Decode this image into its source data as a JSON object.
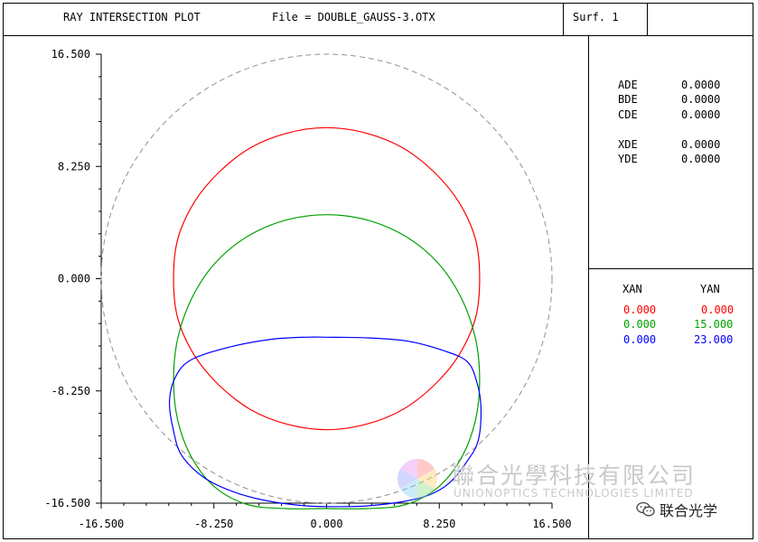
{
  "header": {
    "title": "RAY INTERSECTION PLOT",
    "file_label": "File = DOUBLE_GAUSS-3.OTX",
    "surface_label": "Surf. 1"
  },
  "decenters": [
    {
      "name": "ADE",
      "value": "0.0000"
    },
    {
      "name": "BDE",
      "value": "0.0000"
    },
    {
      "name": "CDE",
      "value": "0.0000"
    },
    {
      "name": "XDE",
      "value": "0.0000"
    },
    {
      "name": "YDE",
      "value": "0.0000"
    }
  ],
  "field_table": {
    "headers": [
      "XAN",
      "YAN"
    ],
    "rows": [
      {
        "xan": "0.000",
        "yan": "0.000",
        "color": "#ff0000"
      },
      {
        "xan": "0.000",
        "yan": "15.000",
        "color": "#00a000"
      },
      {
        "xan": "0.000",
        "yan": "23.000",
        "color": "#0000ff"
      }
    ]
  },
  "watermark": {
    "company_cn": "聯合光學科技有限公司",
    "company_en": "UNIONOPTICS TECHNOLOGIES LIMITED",
    "wechat": "联合光学"
  },
  "chart_data": {
    "type": "line",
    "xlim": [
      -16.5,
      16.5
    ],
    "ylim": [
      -16.5,
      16.5
    ],
    "x_tick_labels": [
      "-16.500",
      "-8.250",
      "0.000",
      "8.250",
      "16.500"
    ],
    "y_tick_labels": [
      "16.500",
      "8.250",
      "0.000",
      "-8.250",
      "-16.500"
    ],
    "x_ticks": [
      -16.5,
      -8.25,
      0,
      8.25,
      16.5
    ],
    "y_ticks": [
      16.5,
      8.25,
      0,
      -8.25,
      -16.5
    ],
    "aperture": {
      "cx": 0,
      "cy": 0,
      "r": 16.5,
      "style": "dashed",
      "color": "#909090"
    },
    "series": [
      {
        "color": "#ff0000",
        "field_yan": 0,
        "points": [
          [
            0.0,
            11.1
          ],
          [
            2.9,
            10.7
          ],
          [
            5.6,
            9.6
          ],
          [
            7.9,
            7.8
          ],
          [
            9.7,
            5.6
          ],
          [
            10.9,
            2.9
          ],
          [
            11.2,
            0.0
          ],
          [
            10.9,
            -2.9
          ],
          [
            9.7,
            -5.6
          ],
          [
            7.9,
            -7.8
          ],
          [
            5.6,
            -9.6
          ],
          [
            2.9,
            -10.7
          ],
          [
            0.0,
            -11.1
          ],
          [
            -2.9,
            -10.7
          ],
          [
            -5.6,
            -9.6
          ],
          [
            -7.9,
            -7.8
          ],
          [
            -9.7,
            -5.6
          ],
          [
            -10.9,
            -2.9
          ],
          [
            -11.2,
            0.0
          ],
          [
            -10.9,
            2.9
          ],
          [
            -9.7,
            5.6
          ],
          [
            -7.9,
            7.8
          ],
          [
            -5.6,
            9.6
          ],
          [
            -2.9,
            10.7
          ],
          [
            0.0,
            11.1
          ]
        ]
      },
      {
        "color": "#00a000",
        "field_yan": 15,
        "points": [
          [
            0.0,
            4.7
          ],
          [
            3.0,
            4.3
          ],
          [
            5.8,
            3.1
          ],
          [
            8.2,
            1.1
          ],
          [
            9.9,
            -1.5
          ],
          [
            10.9,
            -4.4
          ],
          [
            11.2,
            -7.4
          ],
          [
            10.9,
            -10.4
          ],
          [
            9.9,
            -13.1
          ],
          [
            8.2,
            -15.3
          ],
          [
            5.8,
            -16.6
          ],
          [
            3.0,
            -16.9
          ],
          [
            0.0,
            -16.9
          ],
          [
            -3.0,
            -16.9
          ],
          [
            -5.8,
            -16.6
          ],
          [
            -8.2,
            -15.3
          ],
          [
            -9.9,
            -13.1
          ],
          [
            -10.9,
            -10.4
          ],
          [
            -11.2,
            -7.4
          ],
          [
            -10.9,
            -4.4
          ],
          [
            -9.9,
            -1.5
          ],
          [
            -8.2,
            1.1
          ],
          [
            -5.8,
            3.1
          ],
          [
            -3.0,
            4.3
          ],
          [
            0.0,
            4.7
          ]
        ]
      },
      {
        "color": "#0000ff",
        "field_yan": 23,
        "points": [
          [
            0.0,
            -4.3
          ],
          [
            3.0,
            -4.35
          ],
          [
            6.0,
            -4.6
          ],
          [
            8.6,
            -5.3
          ],
          [
            10.3,
            -6.1
          ],
          [
            11.0,
            -7.6
          ],
          [
            11.3,
            -9.5
          ],
          [
            11.1,
            -11.9
          ],
          [
            10.3,
            -13.4
          ],
          [
            9.0,
            -15.0
          ],
          [
            7.5,
            -15.9
          ],
          [
            5.5,
            -16.4
          ],
          [
            3.0,
            -16.7
          ],
          [
            1.0,
            -16.75
          ],
          [
            -1.5,
            -16.7
          ],
          [
            -4.5,
            -16.3
          ],
          [
            -7.0,
            -15.6
          ],
          [
            -9.0,
            -14.6
          ],
          [
            -10.6,
            -13.0
          ],
          [
            -11.2,
            -11.2
          ],
          [
            -11.5,
            -9.0
          ],
          [
            -11.0,
            -7.1
          ],
          [
            -9.8,
            -5.9
          ],
          [
            -7.0,
            -5.0
          ],
          [
            -4.0,
            -4.45
          ],
          [
            -1.5,
            -4.3
          ],
          [
            0.0,
            -4.3
          ]
        ]
      }
    ]
  }
}
